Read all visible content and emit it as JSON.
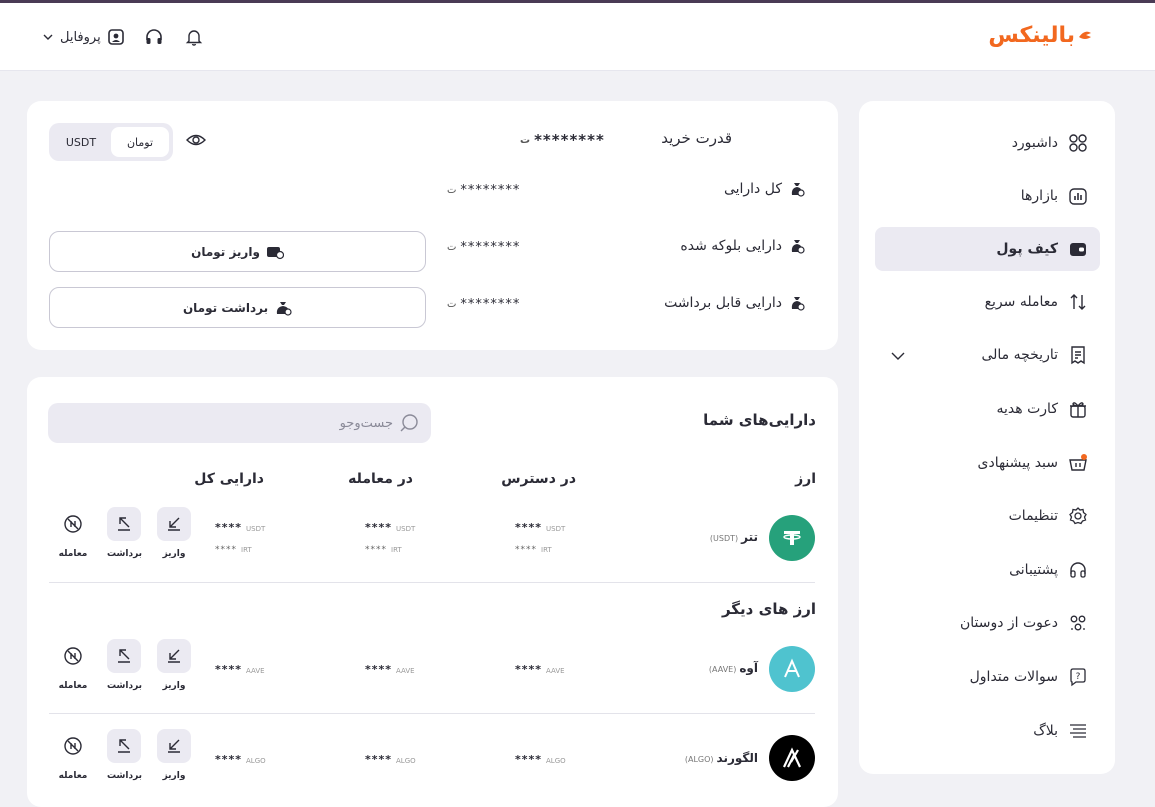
{
  "brand": {
    "name": "بالینکس",
    "color": "#f2681f"
  },
  "header": {
    "profile_label": "پروفایل",
    "icons": [
      "profile-icon",
      "headset-icon",
      "bell-icon",
      "chevron-down-icon"
    ]
  },
  "sidebar": {
    "items": [
      {
        "label": "داشبورد",
        "icon": "dashboard-icon"
      },
      {
        "label": "بازارها",
        "icon": "markets-icon"
      },
      {
        "label": "کیف پول",
        "icon": "wallet-icon",
        "active": true
      },
      {
        "label": "معامله سریع",
        "icon": "swap-icon"
      },
      {
        "label": "تاریخچه مالی",
        "icon": "receipt-icon"
      },
      {
        "label": "کارت هدیه",
        "icon": "gift-icon"
      },
      {
        "label": "سبد پیشنهادی",
        "icon": "basket-icon"
      },
      {
        "label": "تنظیمات",
        "icon": "settings-icon"
      },
      {
        "label": "پشتیبانی",
        "icon": "headset-icon"
      },
      {
        "label": "دعوت از دوستان",
        "icon": "invite-icon"
      },
      {
        "label": "سوالات متداول",
        "icon": "faq-icon"
      },
      {
        "label": "بلاگ",
        "icon": "blog-icon"
      }
    ]
  },
  "balance": {
    "toggle": {
      "usdt": "USDT",
      "toman": "تومان",
      "selected": "تومان"
    },
    "buying_power_label": "قدرت خرید",
    "buying_power_value": "********",
    "total_label": "کل دارایی",
    "total_value": "********",
    "blocked_label": "دارایی بلوکه شده",
    "blocked_value": "********",
    "withdrawable_label": "دارایی قابل برداشت",
    "withdrawable_value": "********",
    "deposit_button": "واریز تومان",
    "withdraw_button": "برداشت تومان"
  },
  "assets": {
    "title": "دارایی‌های شما",
    "search_placeholder": "جست‌وجو",
    "columns": {
      "currency": "ارز",
      "available": "در دسترس",
      "in_trade": "در معامله",
      "total": "دارایی کل"
    },
    "actions": {
      "deposit": "واریز",
      "withdraw": "برداشت",
      "trade": "معامله"
    },
    "other_title": "ارز های دیگر",
    "rows": [
      {
        "name": "تتر",
        "symbol": "(USDT)",
        "stars": "****",
        "unit": "USDT",
        "sub_stars": "****",
        "sub_unit": "IRT",
        "color": "#26a17b"
      },
      {
        "name": "آوه",
        "symbol": "(AAVE)",
        "stars": "****",
        "unit": "AAVE",
        "color": "#4fc3cf"
      },
      {
        "name": "الگورند",
        "symbol": "(ALGO)",
        "stars": "****",
        "unit": "ALGO",
        "color": "#000000"
      }
    ]
  }
}
